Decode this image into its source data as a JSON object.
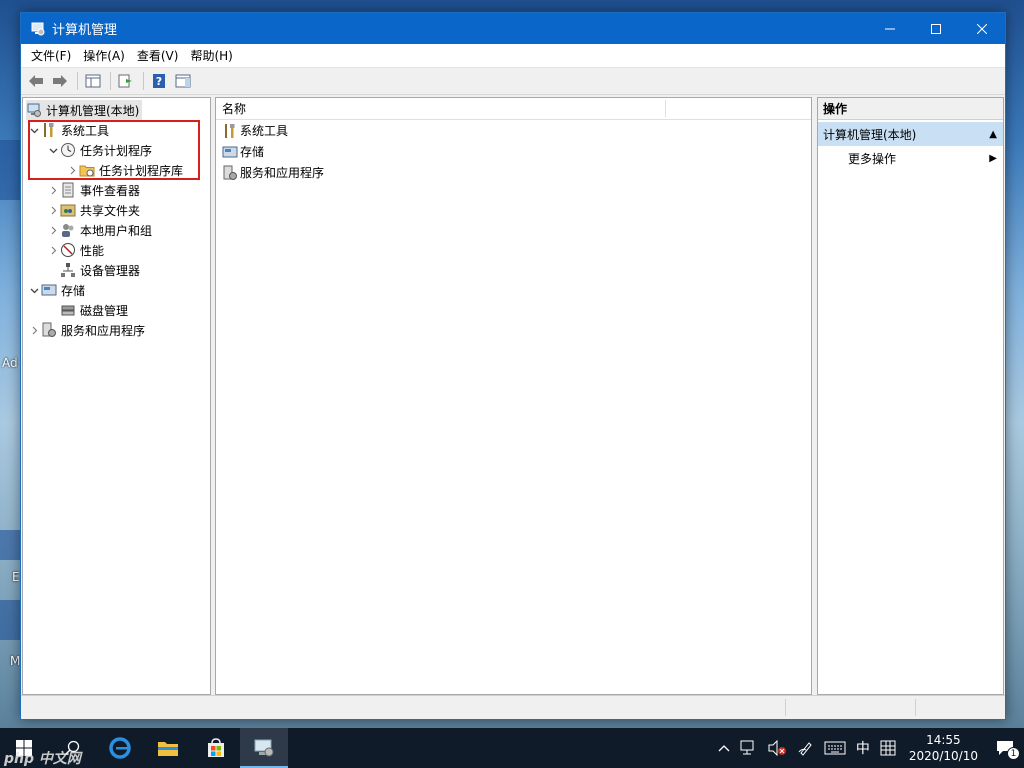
{
  "window": {
    "title": "计算机管理",
    "menu": [
      "文件(F)",
      "操作(A)",
      "查看(V)",
      "帮助(H)"
    ]
  },
  "tree": {
    "root": "计算机管理(本地)",
    "items": [
      {
        "label": "系统工具",
        "icon": "tools-icon",
        "expander": "open"
      },
      {
        "label": "任务计划程序",
        "icon": "clock-icon",
        "expander": "open"
      },
      {
        "label": "任务计划程序库",
        "icon": "folder-icon",
        "expander": "closed"
      },
      {
        "label": "事件查看器",
        "icon": "event-viewer-icon",
        "expander": "closed"
      },
      {
        "label": "共享文件夹",
        "icon": "shared-folder-icon",
        "expander": "closed"
      },
      {
        "label": "本地用户和组",
        "icon": "users-icon",
        "expander": "closed"
      },
      {
        "label": "性能",
        "icon": "performance-icon",
        "expander": "closed"
      },
      {
        "label": "设备管理器",
        "icon": "device-manager-icon",
        "expander": "none"
      },
      {
        "label": "存储",
        "icon": "storage-icon",
        "expander": "open"
      },
      {
        "label": "磁盘管理",
        "icon": "disk-icon",
        "expander": "none"
      },
      {
        "label": "服务和应用程序",
        "icon": "services-icon",
        "expander": "closed"
      }
    ]
  },
  "list": {
    "column_name": "名称",
    "rows": [
      "系统工具",
      "存储",
      "服务和应用程序"
    ]
  },
  "actions": {
    "header": "操作",
    "section": "计算机管理(本地)",
    "item": "更多操作"
  },
  "taskbar": {
    "ime": "中",
    "time": "14:55",
    "date": "2020/10/10",
    "notification_count": "1"
  },
  "desktop": {
    "fragment_ad": "Ad",
    "fragment_e": "E",
    "fragment_m": "M",
    "watermark": "php 中文网"
  },
  "colors": {
    "titlebar": "#0a66c9",
    "highlight_box": "#d8201a",
    "actions_section": "#c9dff3",
    "taskbar": "#101b2a"
  }
}
